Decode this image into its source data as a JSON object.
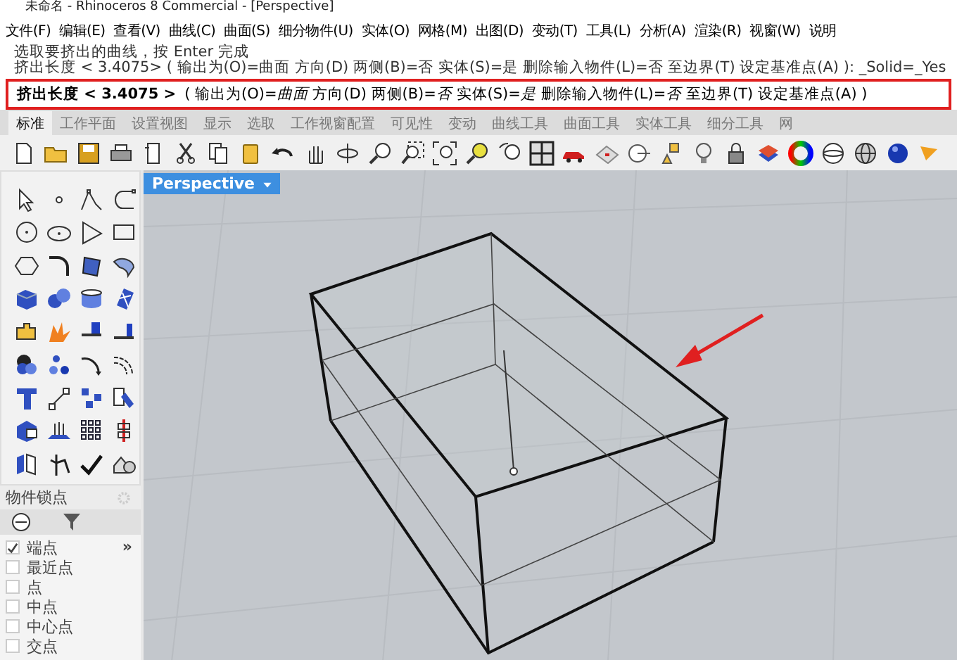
{
  "window": {
    "title": "未命名 - Rhinoceros 8 Commercial - [Perspective]"
  },
  "menu": [
    "文件(F)",
    "编辑(E)",
    "查看(V)",
    "曲线(C)",
    "曲面(S)",
    "细分物件(U)",
    "实体(O)",
    "网格(M)",
    "出图(D)",
    "变动(T)",
    "工具(L)",
    "分析(A)",
    "渲染(R)",
    "视窗(W)",
    "说明"
  ],
  "command_history": [
    "选取要挤出的曲线，按 Enter 完成",
    "挤出长度 < 3.4075> ( 输出为(O)=曲面  方向(D)  两侧(B)=否  实体(S)=是  删除输入物件(L)=否  至边界(T)  设定基准点(A) ): _Solid=_Yes"
  ],
  "command_line": {
    "prompt": "挤出长度 < 3.4075 >",
    "options": "( 输出为(O)=*曲面*  方向(D)  两侧(B)=*否*  实体(S)=*是*  删除输入物件(L)=*否*  至边界(T)  设定基准点(A) )"
  },
  "tabs": [
    {
      "label": "标准",
      "selected": true
    },
    {
      "label": "工作平面",
      "selected": false
    },
    {
      "label": "设置视图",
      "selected": false
    },
    {
      "label": "显示",
      "selected": false
    },
    {
      "label": "选取",
      "selected": false
    },
    {
      "label": "工作视窗配置",
      "selected": false
    },
    {
      "label": "可见性",
      "selected": false
    },
    {
      "label": "变动",
      "selected": false
    },
    {
      "label": "曲线工具",
      "selected": false
    },
    {
      "label": "曲面工具",
      "selected": false
    },
    {
      "label": "实体工具",
      "selected": false
    },
    {
      "label": "细分工具",
      "selected": false
    },
    {
      "label": "网",
      "selected": false
    }
  ],
  "osnap": {
    "title": "物件锁点",
    "more": "»",
    "items": [
      {
        "label": "端点",
        "checked": true
      },
      {
        "label": "最近点",
        "checked": false
      },
      {
        "label": "点",
        "checked": false
      },
      {
        "label": "中点",
        "checked": false
      },
      {
        "label": "中心点",
        "checked": false
      },
      {
        "label": "交点",
        "checked": false
      }
    ]
  },
  "viewport": {
    "title": "Perspective"
  }
}
